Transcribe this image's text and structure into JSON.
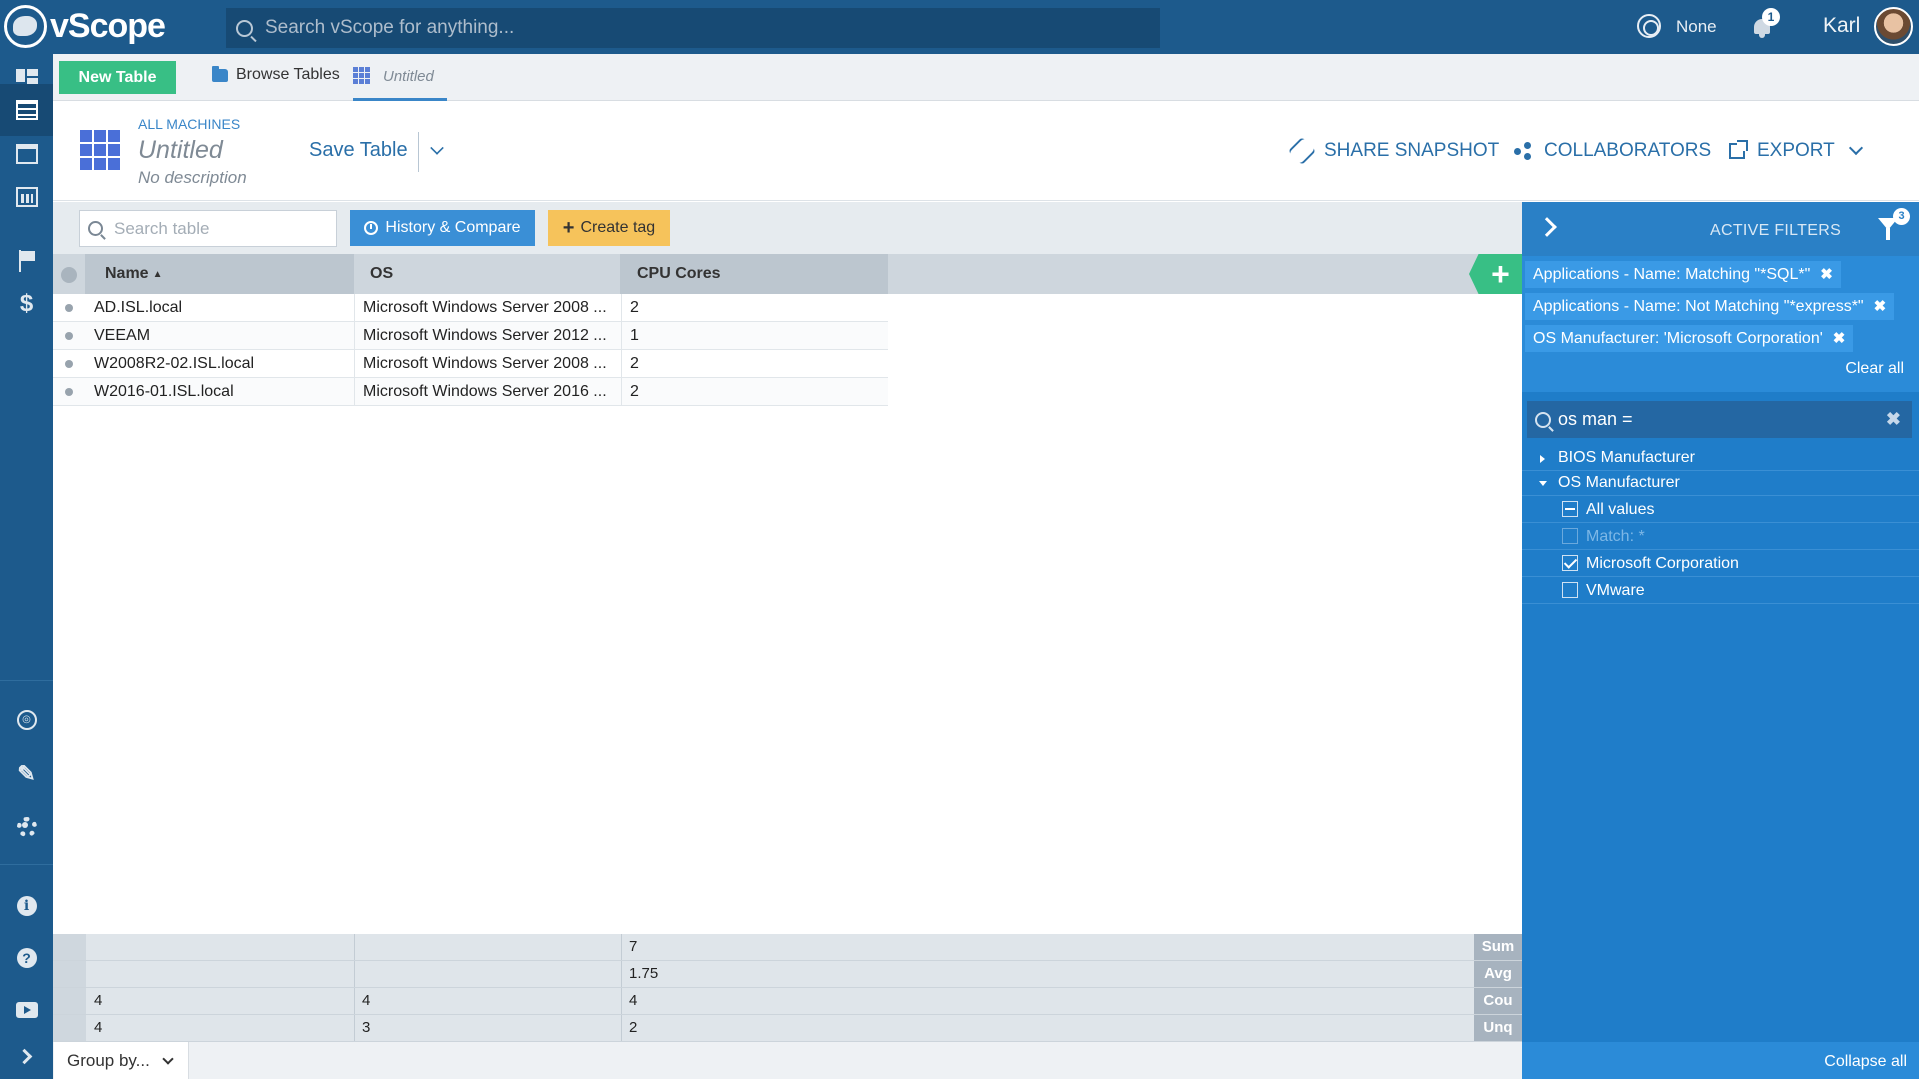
{
  "app": {
    "name": "vScope"
  },
  "header": {
    "search_placeholder": "Search vScope for anything...",
    "status": "None",
    "notifications": "1",
    "user": "Karl"
  },
  "tabs": {
    "new_table": "New Table",
    "browse": "Browse Tables",
    "current": "Untitled"
  },
  "table_header": {
    "scope": "ALL MACHINES",
    "title": "Untitled",
    "description": "No description",
    "save": "Save Table",
    "share": "SHARE SNAPSHOT",
    "collaborators": "COLLABORATORS",
    "export": "EXPORT"
  },
  "toolbar": {
    "search_placeholder": "Search table",
    "history": "History & Compare",
    "create_tag": "Create tag"
  },
  "columns": [
    "Name",
    "OS",
    "CPU Cores"
  ],
  "sort": {
    "column": "Name",
    "direction": "asc",
    "indicator": "▲"
  },
  "rows": [
    {
      "name": "AD.ISL.local",
      "os": "Microsoft Windows Server 2008 ...",
      "cpu": "2"
    },
    {
      "name": "VEEAM",
      "os": "Microsoft Windows Server 2012 ...",
      "cpu": "1"
    },
    {
      "name": "W2008R2-02.ISL.local",
      "os": "Microsoft Windows Server 2008 ...",
      "cpu": "2"
    },
    {
      "name": "W2016-01.ISL.local",
      "os": "Microsoft Windows Server 2016 ...",
      "cpu": "2"
    }
  ],
  "stats": [
    {
      "label": "Sum",
      "name": "",
      "os": "",
      "cpu": "7"
    },
    {
      "label": "Avg",
      "name": "",
      "os": "",
      "cpu": "1.75"
    },
    {
      "label": "Cou",
      "name": "4",
      "os": "4",
      "cpu": "4"
    },
    {
      "label": "Unq",
      "name": "4",
      "os": "3",
      "cpu": "2"
    }
  ],
  "groupby": "Group by...",
  "filters": {
    "title": "ACTIVE FILTERS",
    "count": "3",
    "active": [
      "Applications - Name: Matching \"*SQL*\"",
      "Applications - Name: Not Matching \"*express*\"",
      "OS Manufacturer: 'Microsoft Corporation'"
    ],
    "remove_glyph": "✖",
    "clear_all": "Clear all",
    "search_value": "os man =",
    "tree": {
      "bios": "BIOS Manufacturer",
      "os": "OS Manufacturer",
      "values": [
        {
          "label": "All values",
          "state": "partial"
        },
        {
          "label": "Match: *",
          "state": "disabled"
        },
        {
          "label": "Microsoft Corporation",
          "state": "checked"
        },
        {
          "label": "VMware",
          "state": "unchecked"
        }
      ]
    },
    "collapse_all": "Collapse all"
  },
  "colors": {
    "nav": "#1d5a8c",
    "accent_green": "#38bf85",
    "accent_blue": "#3a8fd6",
    "tag_yellow": "#f6c35b",
    "filters_panel": "#2b8bd8"
  }
}
